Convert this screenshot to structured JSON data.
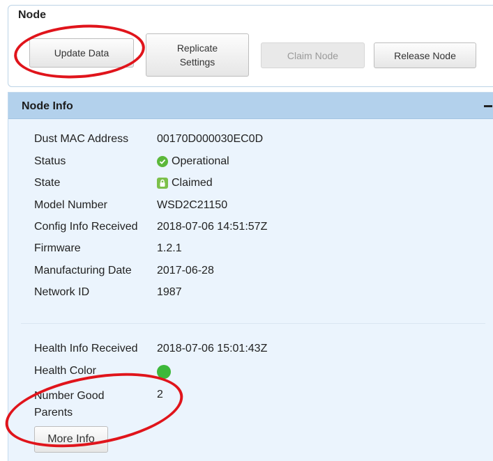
{
  "node_panel": {
    "title": "Node",
    "buttons": {
      "update_data": "Update Data",
      "replicate_settings": "Replicate Settings",
      "claim_node": "Claim Node",
      "release_node": "Release Node"
    }
  },
  "node_info": {
    "title": "Node Info",
    "fields": [
      {
        "label": "Dust MAC Address",
        "value": "00170D000030EC0D"
      },
      {
        "label": "Status",
        "value": "Operational",
        "icon": "check-icon"
      },
      {
        "label": "State",
        "value": "Claimed",
        "icon": "lock-icon"
      },
      {
        "label": "Model Number",
        "value": "WSD2C21150"
      },
      {
        "label": "Config Info Received",
        "value": "2018-07-06 14:51:57Z"
      },
      {
        "label": "Firmware",
        "value": "1.2.1"
      },
      {
        "label": "Manufacturing Date",
        "value": "2017-06-28"
      },
      {
        "label": "Network ID",
        "value": "1987"
      }
    ],
    "health": [
      {
        "label": "Health Info Received",
        "value": "2018-07-06 15:01:43Z"
      },
      {
        "label": "Health Color",
        "value": "",
        "color": "#3db83a"
      },
      {
        "label": "Number Good Parents",
        "value": "2"
      }
    ],
    "more_info_label": "More Info"
  },
  "colors": {
    "header_bg": "#b3d1ec",
    "panel_bg": "#ebf4fd",
    "annotation": "#e0141b",
    "status_green": "#5cb83a"
  }
}
